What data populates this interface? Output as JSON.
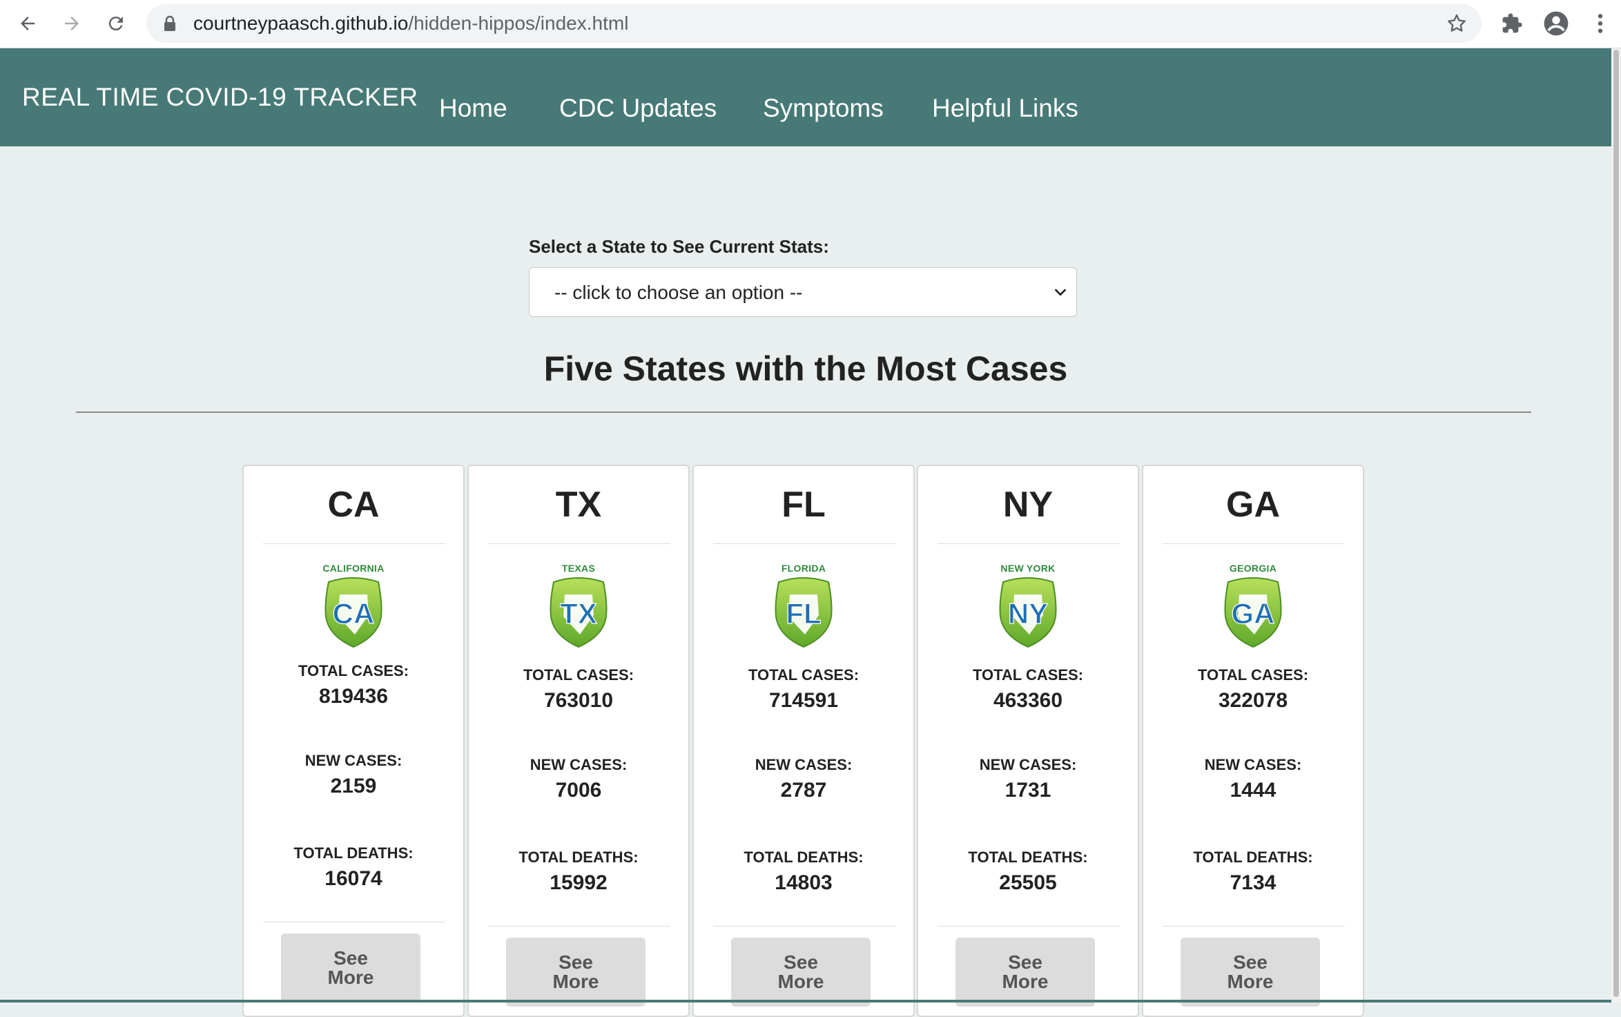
{
  "browser": {
    "url_host": "courtneypaasch.github.io",
    "url_path": "/hidden-hippos/index.html"
  },
  "site": {
    "brand": "REAL TIME COVID-19 TRACKER",
    "nav": [
      "Home",
      "CDC Updates",
      "Symptoms",
      "Helpful Links"
    ]
  },
  "selector": {
    "label": "Select a State to See Current Stats:",
    "value": "-- click to choose an option --"
  },
  "section_title": "Five States with the Most Cases",
  "labels": {
    "total_cases": "TOTAL CASES:",
    "new_cases": "NEW CASES:",
    "total_deaths": "TOTAL DEATHS:",
    "see_more_1": "See",
    "see_more_2": "More"
  },
  "colors": {
    "navbar": "#477a77",
    "shield_green": "#8cc63f",
    "shield_letters": "#1f6fb5"
  },
  "states": [
    {
      "abbr": "CA",
      "name": "CALIFORNIA",
      "total_cases": "819436",
      "new_cases": "2159",
      "total_deaths": "16074"
    },
    {
      "abbr": "TX",
      "name": "TEXAS",
      "total_cases": "763010",
      "new_cases": "7006",
      "total_deaths": "15992"
    },
    {
      "abbr": "FL",
      "name": "FLORIDA",
      "total_cases": "714591",
      "new_cases": "2787",
      "total_deaths": "14803"
    },
    {
      "abbr": "NY",
      "name": "NEW YORK",
      "total_cases": "463360",
      "new_cases": "1731",
      "total_deaths": "25505"
    },
    {
      "abbr": "GA",
      "name": "GEORGIA",
      "total_cases": "322078",
      "new_cases": "1444",
      "total_deaths": "7134"
    }
  ]
}
